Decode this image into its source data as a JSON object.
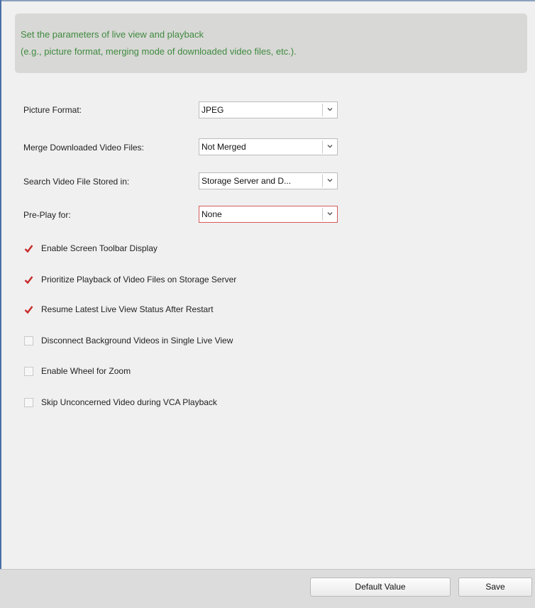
{
  "info": {
    "line1": "Set the parameters of live view and playback",
    "line2": "(e.g., picture format, merging mode of downloaded video files, etc.)."
  },
  "fields": [
    {
      "label": "Picture Format:",
      "value": "JPEG"
    },
    {
      "label": "Merge Downloaded Video Files:",
      "value": "Not Merged"
    },
    {
      "label": "Search Video File Stored in:",
      "value": "Storage Server and D..."
    },
    {
      "label": "Pre-Play for:",
      "value": "None"
    }
  ],
  "options": [
    {
      "label": "Enable Screen Toolbar Display",
      "checked": true
    },
    {
      "label": "Prioritize Playback of Video Files on Storage Server",
      "checked": true
    },
    {
      "label": "Resume Latest Live View Status After Restart",
      "checked": true
    },
    {
      "label": "Disconnect Background Videos in Single Live View",
      "checked": false
    },
    {
      "label": "Enable Wheel for Zoom",
      "checked": false
    },
    {
      "label": "Skip Unconcerned Video during VCA Playback",
      "checked": false
    }
  ],
  "buttons": {
    "default": "Default Value",
    "save": "Save"
  },
  "colors": {
    "info_text": "#3f8a3f",
    "check_mark": "#c62b2b",
    "active_select_border": "#d65a5a"
  },
  "icons": {
    "dropdown": "chevron-down-icon",
    "check": "checkmark-icon"
  }
}
